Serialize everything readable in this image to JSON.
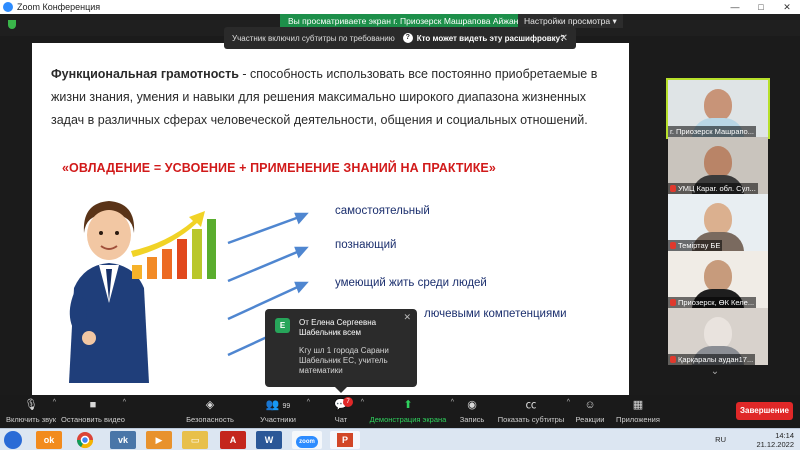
{
  "window": {
    "title": "Zoom Конференция",
    "controls": [
      "—",
      "□",
      "✕"
    ]
  },
  "share_banner": {
    "text": "Вы просматриваете экран г. Приозерск Машрапова Айжан",
    "view_options": "Настройки просмотра ▾"
  },
  "captions": {
    "text": "Участник включил субтитры по требованию",
    "who_can_see": "Кто может видеть эту расшифровку?",
    "close": "✕"
  },
  "slide": {
    "def_bold": "Функциональная грамотность",
    "def_rest": " -  способность использовать все постоянно приобретаемые в жизни знания, умения и навыки для решения максимально широкого диапазона жизненных задач в различных сферах человеческой деятельности, общения и социальных отношений.",
    "motto": "«ОВЛАДЕНИЕ = УСВОЕНИЕ + ПРИМЕНЕНИЕ ЗНАНИЙ НА ПРАКТИКЕ»",
    "traits": [
      "самостоятельный",
      "познающий",
      "умеющий жить среди людей",
      "лючевыми компетенциями"
    ]
  },
  "chat_popup": {
    "avatar_letter": "E",
    "from": "От Елена Сергеевна Шабельник всем",
    "message": "Kгу шл 1 города Сарани Шабельник ЕС, учитель математики",
    "close": "✕"
  },
  "participants": [
    {
      "name": "г. Приозерск Машрапо...",
      "muted": false,
      "active": true
    },
    {
      "name": "УМЦ Караг. обл. Сул...",
      "muted": true,
      "active": false
    },
    {
      "name": "Теміртау БЕ",
      "muted": true,
      "active": false
    },
    {
      "name": "Приозерск, ӨК Келе...",
      "muted": true,
      "active": false
    },
    {
      "name": "Қарқаралы аудан17...",
      "muted": true,
      "active": false
    }
  ],
  "scroll_down": "⌄",
  "toolbar": {
    "unmute": "Включить звук",
    "start_video": "Остановить видео",
    "security": "Безопасность",
    "participants": "Участники",
    "participants_count": "99",
    "chat": "Чат",
    "chat_badge": "7",
    "share": "Демонстрация экрана",
    "record": "Запись",
    "captions": "Показать субтитры",
    "reactions": "Реакции",
    "apps": "Приложения",
    "end": "Завершение"
  },
  "taskbar": {
    "apps": [
      "Одноклассники",
      "Chrome",
      "VK",
      "Медиа",
      "Проводник",
      "PDF",
      "Word",
      "Zoom",
      "PowerPoint"
    ],
    "lang": "RU",
    "time": "14:14",
    "date": "21.12.2022"
  },
  "colors": {
    "share_green": "#1d8f4a",
    "motto_red": "#d11a1a",
    "end_red": "#e02828",
    "active_tile": "#b7e02b"
  }
}
